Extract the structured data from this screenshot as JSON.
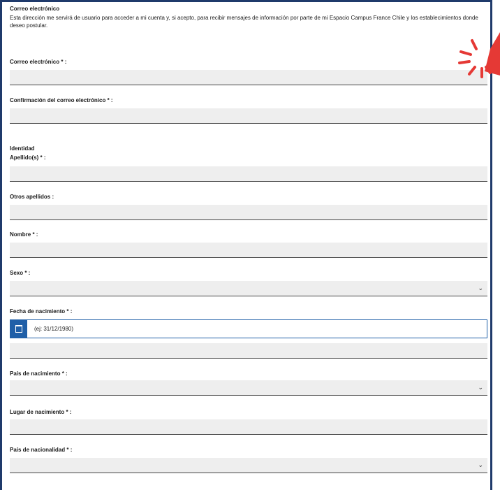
{
  "section": {
    "title": "Correo electrónico",
    "description": "Esta dirección me servirá de usuario para acceder a mi cuenta y, si acepto, para recibir mensajes de información por parte de mi Espacio Campus France Chile y los establecimientos donde deseo postular."
  },
  "fields": {
    "email": {
      "label": "Correo electrónico * :"
    },
    "email_confirm": {
      "label": "Confirmación del correo electrónico * :"
    },
    "identity_heading": "Identidad",
    "surname": {
      "label": "Apellido(s) * :"
    },
    "other_surnames": {
      "label": "Otros apellidos :"
    },
    "first_name": {
      "label": "Nombre * :"
    },
    "sex": {
      "label": "Sexo * :"
    },
    "birth_date": {
      "label": "Fecha de nacimiento * :",
      "placeholder": "(ej: 31/12/1980)"
    },
    "birth_country": {
      "label": "País de nacimiento * :"
    },
    "birth_place": {
      "label": "Lugar de nacimiento * :"
    },
    "nationality_country": {
      "label": "País de nacionalidad * :"
    }
  },
  "icons": {
    "dropdown": "chevron-down-icon",
    "calendar": "calendar-icon",
    "highlight": "attention-burst-icon"
  },
  "colors": {
    "accent": "#1f5fa8",
    "frame": "#1f3a6b",
    "field_bg": "#eeeeee",
    "highlight": "#e53935"
  }
}
